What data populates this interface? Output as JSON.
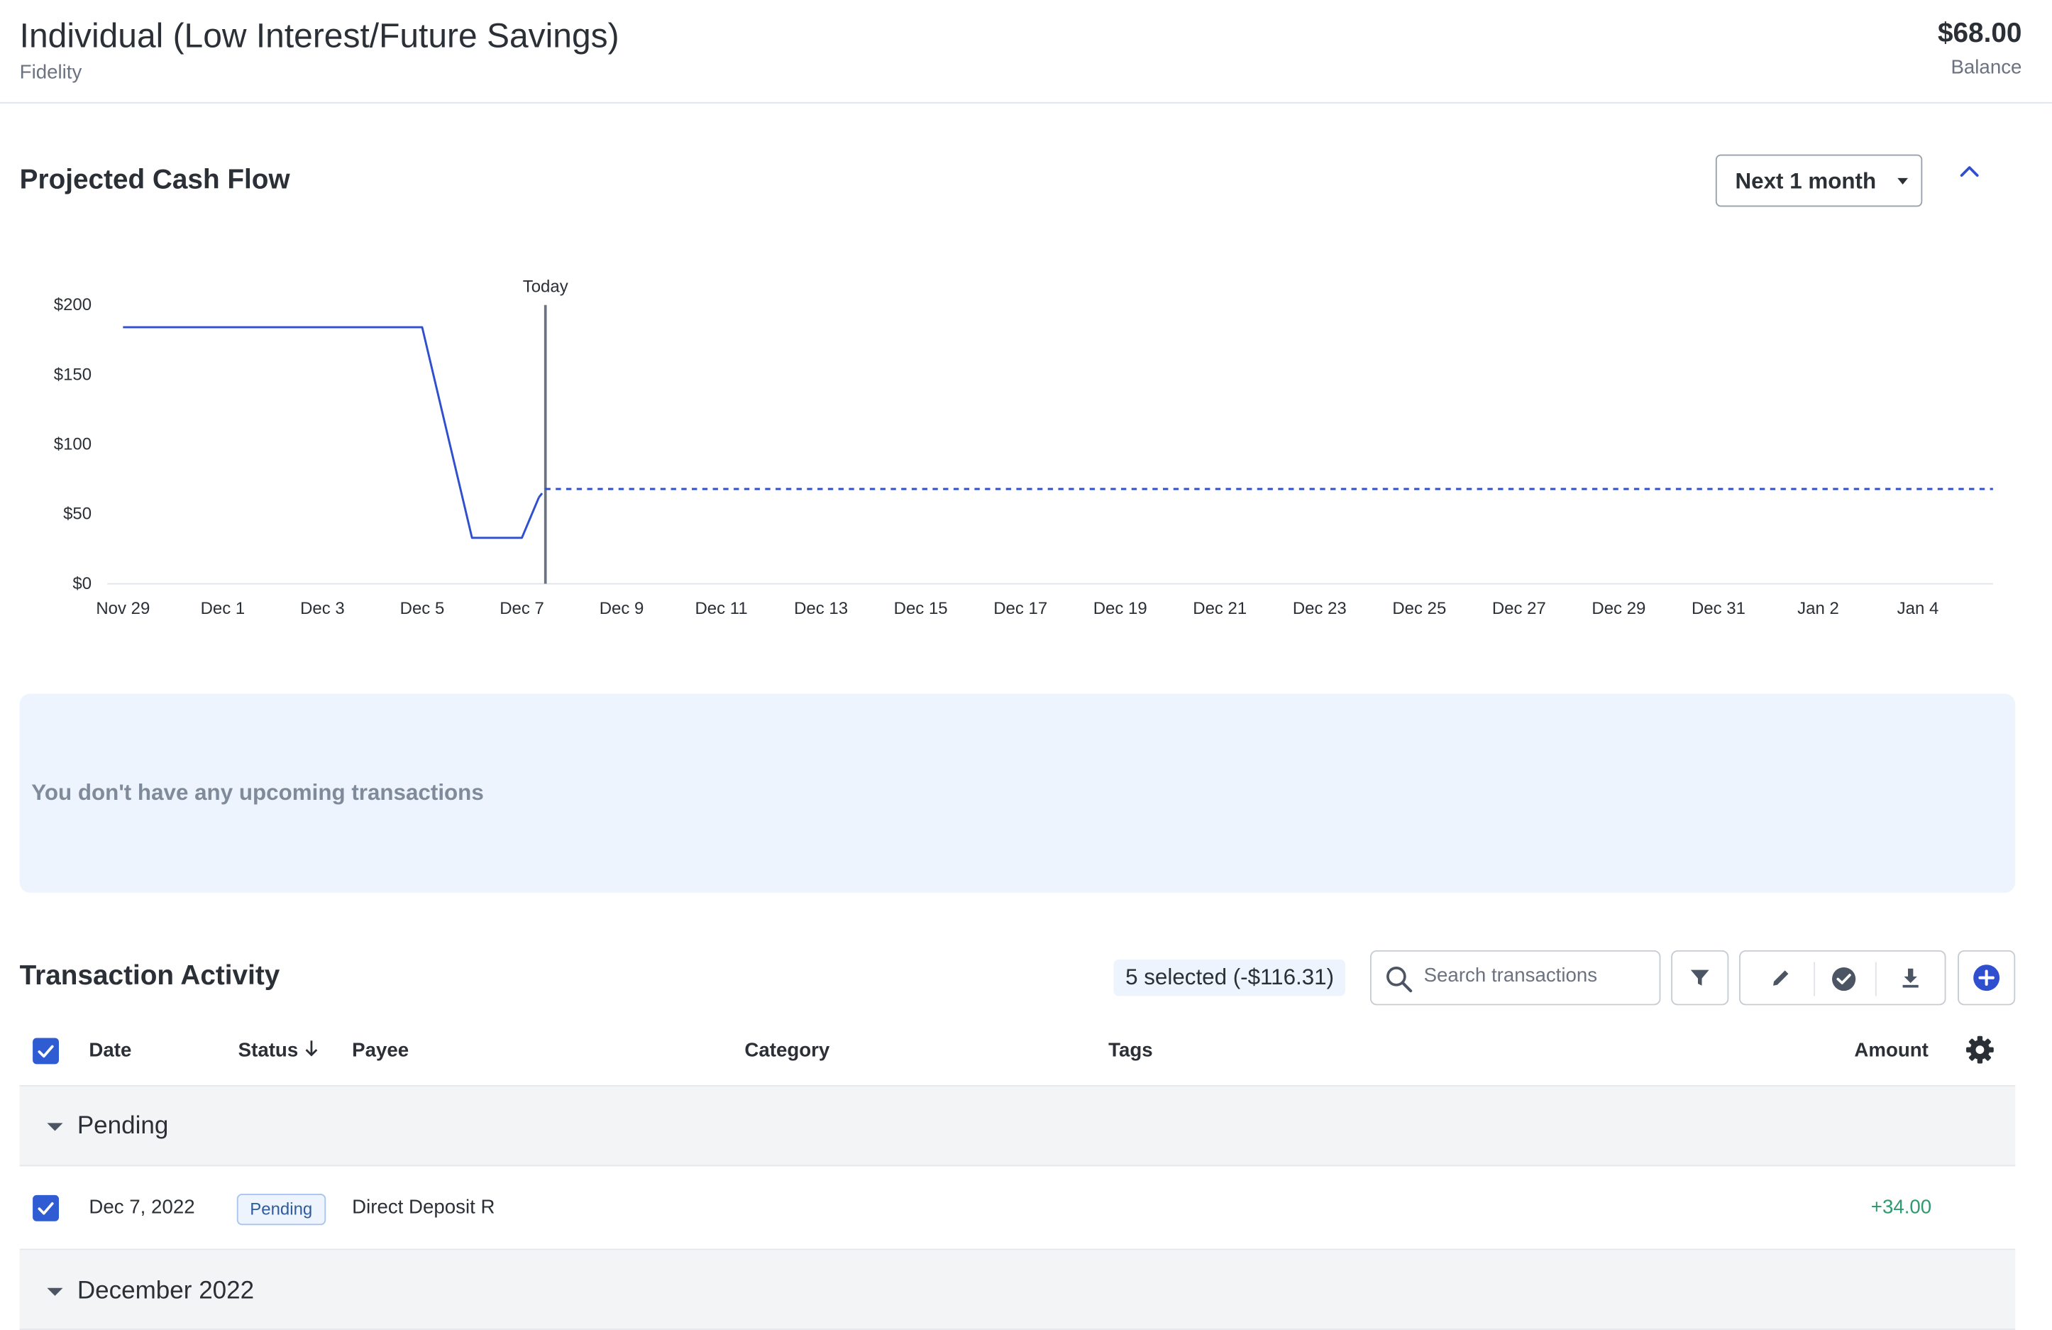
{
  "account": {
    "name": "Individual (Low Interest/Future Savings)",
    "institution": "Fidelity",
    "balance": "$68.00",
    "balance_label": "Balance"
  },
  "projected": {
    "title": "Projected Cash Flow",
    "range_label": "Next 1 month"
  },
  "chart_data": {
    "type": "line",
    "title": "",
    "xlabel": "",
    "ylabel": "",
    "ylim": [
      0,
      200
    ],
    "y_ticks": [
      "$200",
      "$150",
      "$100",
      "$50",
      "$0"
    ],
    "x_ticks": [
      "Nov 29",
      "Dec 1",
      "Dec 3",
      "Dec 5",
      "Dec 7",
      "Dec 9",
      "Dec 11",
      "Dec 13",
      "Dec 15",
      "Dec 17",
      "Dec 19",
      "Dec 21",
      "Dec 23",
      "Dec 25",
      "Dec 27",
      "Dec 29",
      "Dec 31",
      "Jan 2",
      "Jan 4"
    ],
    "today_label": "Today",
    "today_date": "Dec 7",
    "series": [
      {
        "style": "solid",
        "color": "#2f4fcf",
        "points": [
          {
            "x": "Nov 29",
            "y": 184
          },
          {
            "x": "Dec 1",
            "y": 184
          },
          {
            "x": "Dec 5",
            "y": 184
          },
          {
            "x": "Dec 6",
            "y": 33
          },
          {
            "x": "Dec 7",
            "y": 33
          },
          {
            "x": "Dec 8",
            "y": 62
          }
        ]
      },
      {
        "style": "dashed",
        "color": "#2f4fcf",
        "points": [
          {
            "x": "Dec 8",
            "y": 62
          },
          {
            "x": "Dec 8",
            "y": 68
          },
          {
            "x": "Jan 5",
            "y": 68
          }
        ]
      }
    ],
    "grid": false
  },
  "upcoming": {
    "empty_message": "You don't have any upcoming transactions"
  },
  "transactions": {
    "title": "Transaction Activity",
    "selected_summary": "5 selected (-$116.31)",
    "search_placeholder": "Search transactions",
    "columns": {
      "date": "Date",
      "status": "Status",
      "payee": "Payee",
      "category": "Category",
      "tags": "Tags",
      "amount": "Amount"
    },
    "groups": [
      {
        "label": "Pending",
        "rows": [
          {
            "date": "Dec 7, 2022",
            "status": "Pending",
            "payee": "Direct Deposit R",
            "category": "",
            "tags": "",
            "amount": "+34.00"
          }
        ]
      },
      {
        "label": "December 2022",
        "rows": []
      }
    ]
  },
  "colors": {
    "accent": "#2f4fcf",
    "positive": "#2f9a6e",
    "upcoming_bg": "#edf4fd"
  }
}
